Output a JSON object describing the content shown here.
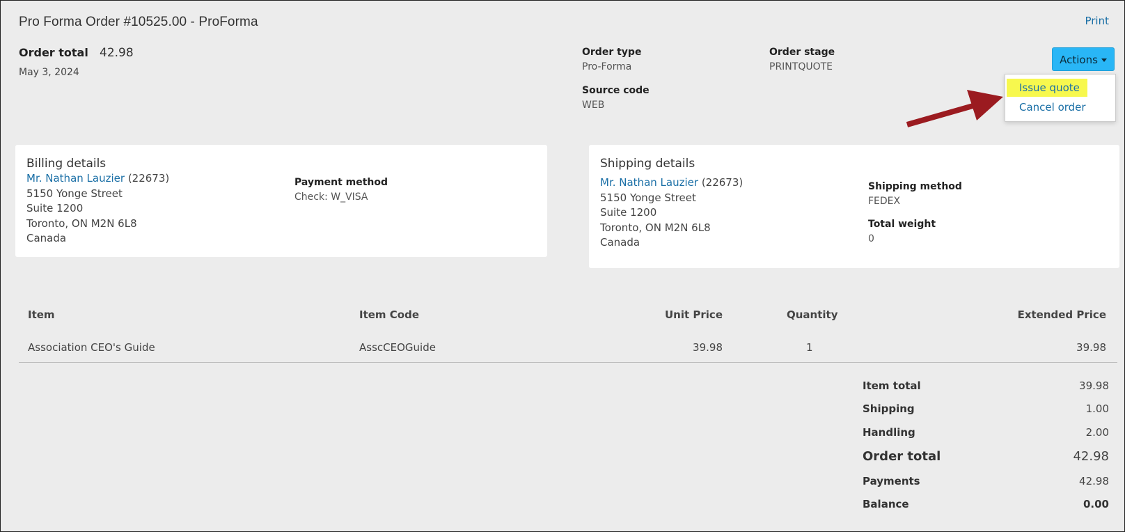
{
  "header": {
    "title": "Pro Forma Order #10525.00 - ProForma",
    "print_label": "Print",
    "order_total_label": "Order total",
    "order_total_value": "42.98",
    "date": "May 3, 2024"
  },
  "meta": {
    "order_type_label": "Order type",
    "order_type_value": "Pro-Forma",
    "order_stage_label": "Order stage",
    "order_stage_value": "PRINTQUOTE",
    "source_code_label": "Source code",
    "source_code_value": "WEB"
  },
  "actions": {
    "button_label": "Actions",
    "menu": [
      "Issue quote",
      "Cancel order"
    ]
  },
  "billing": {
    "title": "Billing details",
    "name": "Mr. Nathan Lauzier",
    "id": "(22673)",
    "lines": [
      "5150 Yonge Street",
      "Suite 1200",
      "Toronto, ON M2N 6L8",
      "Canada"
    ],
    "payment_method_label": "Payment method",
    "payment_method_value": "Check: W_VISA"
  },
  "shipping": {
    "title": "Shipping details",
    "name": "Mr. Nathan Lauzier",
    "id": "(22673)",
    "lines": [
      "5150 Yonge Street",
      "Suite 1200",
      "Toronto, ON M2N 6L8",
      "Canada"
    ],
    "method_label": "Shipping method",
    "method_value": "FEDEX",
    "weight_label": "Total weight",
    "weight_value": "0"
  },
  "table": {
    "headers": [
      "Item",
      "Item Code",
      "Unit Price",
      "Quantity",
      "Extended Price"
    ],
    "rows": [
      [
        "Association CEO's Guide",
        "AsscCEOGuide",
        "39.98",
        "1",
        "39.98"
      ]
    ]
  },
  "summary": [
    {
      "label": "Item total",
      "value": "39.98"
    },
    {
      "label": "Shipping",
      "value": "1.00"
    },
    {
      "label": "Handling",
      "value": "2.00"
    },
    {
      "label": "Order total",
      "value": "42.98"
    },
    {
      "label": "Payments",
      "value": "42.98"
    },
    {
      "label": "Balance",
      "value": "0.00"
    }
  ],
  "colors": {
    "background": "#ececec",
    "link": "#1a6fa6",
    "button": "#29b6f6",
    "highlight": "#f7f84e",
    "arrow": "#9b1b20"
  },
  "icons": [
    "caret-down-icon",
    "arrow-annotation"
  ]
}
